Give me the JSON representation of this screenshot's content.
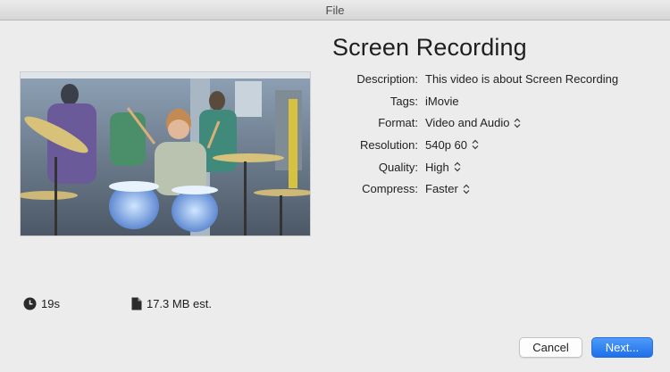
{
  "window": {
    "title": "File"
  },
  "preview": {
    "alt": ""
  },
  "project": {
    "title": "Screen Recording"
  },
  "details": [
    {
      "label": "Description:",
      "value": "This video is about Screen Recording",
      "has_stepper": false
    },
    {
      "label": "Tags:",
      "value": "iMovie",
      "has_stepper": false
    },
    {
      "label": "Format:",
      "value": "Video and Audio",
      "has_stepper": true
    },
    {
      "label": "Resolution:",
      "value": "540p 60",
      "has_stepper": true
    },
    {
      "label": "Quality:",
      "value": "High",
      "has_stepper": true
    },
    {
      "label": "Compress:",
      "value": "Faster",
      "has_stepper": true
    }
  ],
  "stats": {
    "duration": "19s",
    "size": "17.3 MB est."
  },
  "buttons": {
    "cancel": "Cancel",
    "next": "Next..."
  },
  "colors": {
    "accent": "#2a7af0",
    "window_bg": "#ececec"
  }
}
